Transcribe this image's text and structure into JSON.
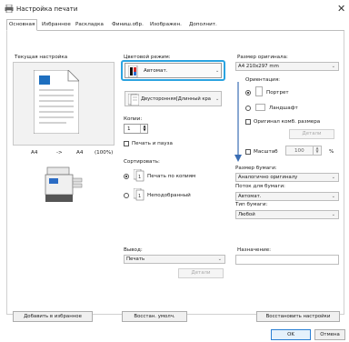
{
  "window": {
    "title": "Настройка печати"
  },
  "tabs": [
    {
      "label": "Основная"
    },
    {
      "label": "Избранное"
    },
    {
      "label": "Раскладка"
    },
    {
      "label": "Финиш.обр."
    },
    {
      "label": "Изображен."
    },
    {
      "label": "Дополнит."
    }
  ],
  "current_settings": {
    "label": "Текущая настройка",
    "size_from": "A4",
    "arrow": "->",
    "size_to": "A4",
    "zoom": "(100%)"
  },
  "color_mode": {
    "label": "Цветовой режим:",
    "value": "Автомат."
  },
  "duplex": {
    "value": "Двусторонняя[Длинный кра"
  },
  "copies": {
    "label": "Копии:",
    "value": "1"
  },
  "print_pause": {
    "label": "Печать и пауза"
  },
  "sorting": {
    "label": "Сортировать:",
    "option1": "Печать по копиям",
    "option2": "Неподобранный"
  },
  "output": {
    "label": "Вывод:",
    "value": "Печать",
    "details": "Детали"
  },
  "original_size": {
    "label": "Размер оригинала:",
    "value": "A4 210x297 mm"
  },
  "orientation": {
    "label": "Ориентация:",
    "portrait": "Портрет",
    "landscape": "Ландшафт"
  },
  "mixed_sizes": {
    "label": "Оригинал комб. размера",
    "details": "Детали"
  },
  "scale": {
    "label": "Масштаб",
    "value": "100",
    "unit": "%"
  },
  "paper_size": {
    "label": "Размер бумаги:",
    "value": "Аналогично оригиналу"
  },
  "paper_tray": {
    "label": "Поток для бумаги:",
    "value": "Автомат."
  },
  "paper_type": {
    "label": "Тип бумаги:",
    "value": "Любой"
  },
  "destination": {
    "label": "Назначение:"
  },
  "buttons": {
    "add_favorite": "Добавить в избранное",
    "restore_default": "Восстан. умолч.",
    "restore_settings": "Восстановить настройки",
    "ok": "OK",
    "cancel": "Отмена"
  },
  "colors": {
    "highlight": "#2aa3e0",
    "arrow": "#3a6db3",
    "ok_border": "#2a7fd4"
  }
}
